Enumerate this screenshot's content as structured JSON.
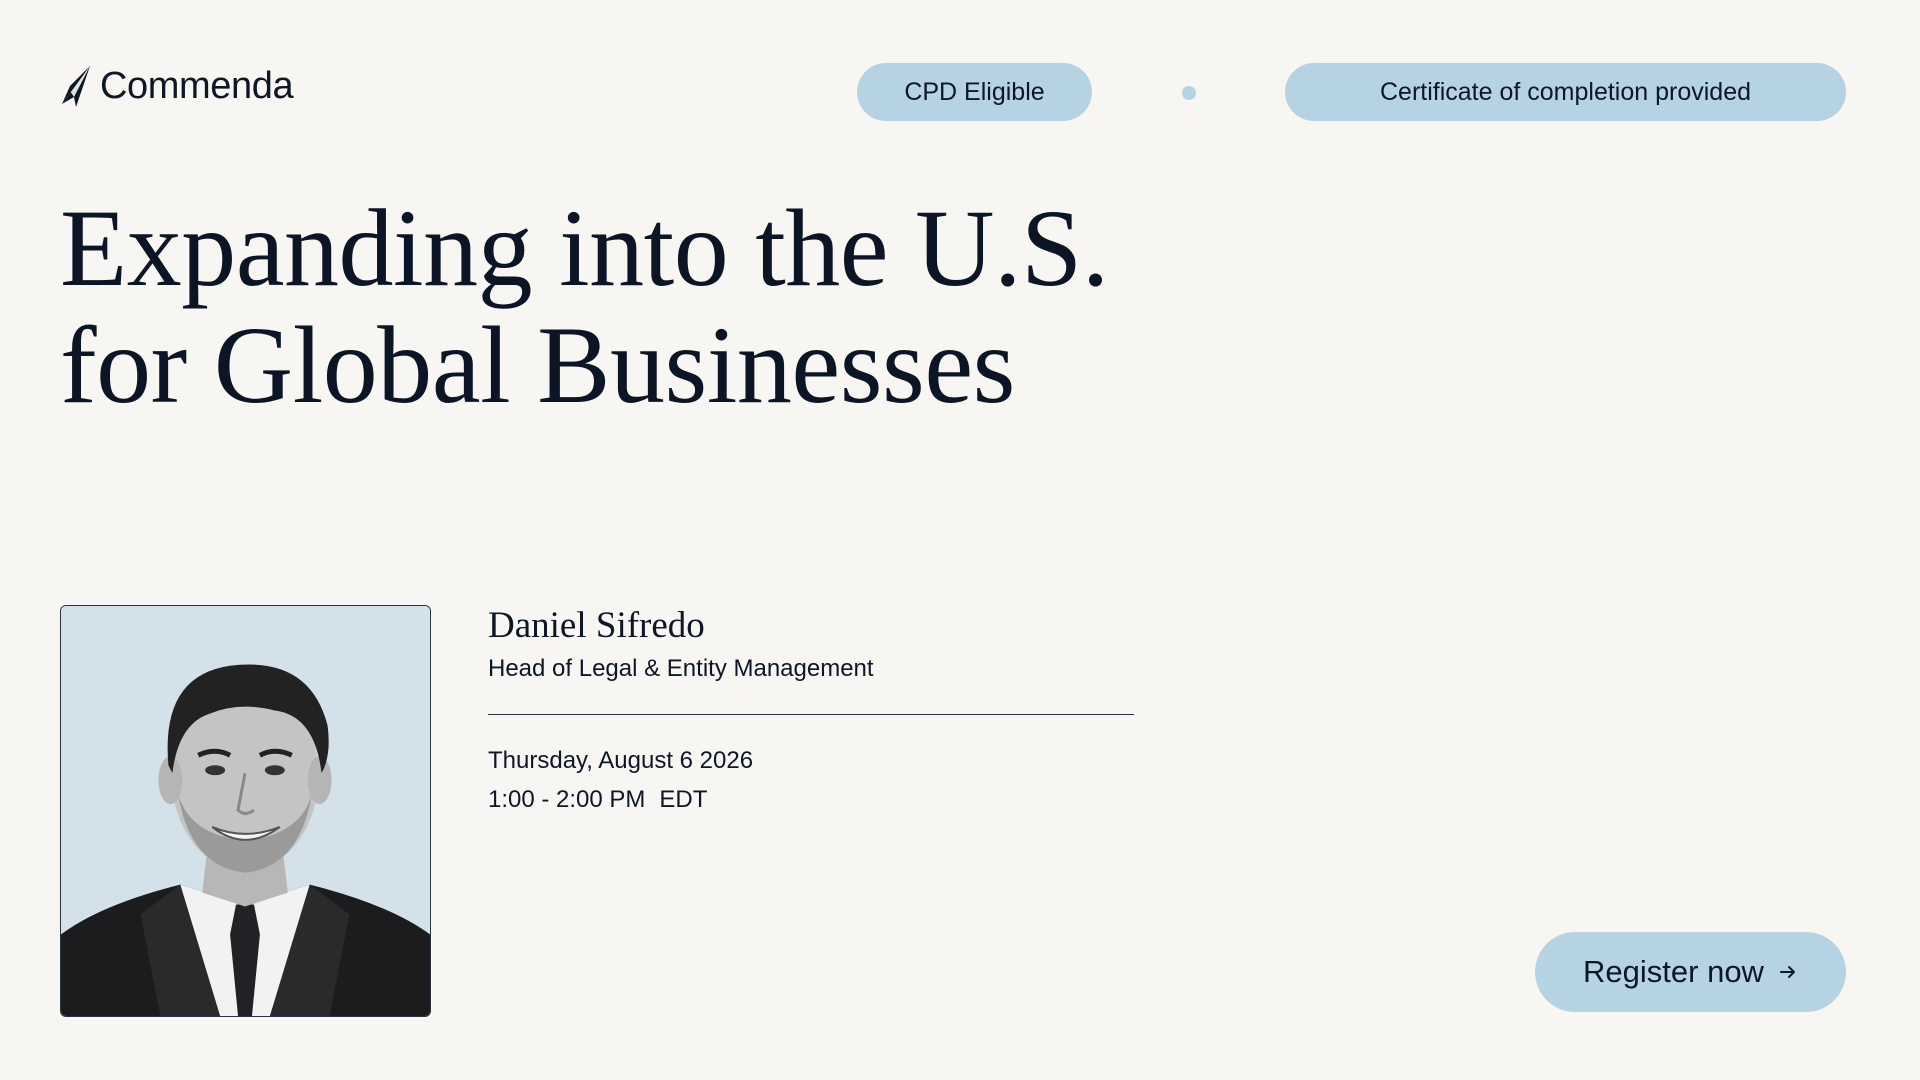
{
  "brand": {
    "name": "Commenda",
    "logo_icon": "paper-plane-icon"
  },
  "badges": {
    "cpd": "CPD Eligible",
    "certificate": "Certificate of completion provided"
  },
  "title": "Expanding into the U.S. for Global Businesses",
  "speaker": {
    "name": "Daniel Sifredo",
    "role": "Head of Legal & Entity Management"
  },
  "event": {
    "date": "Thursday, August 6 2026",
    "time": "1:00 - 2:00 PM",
    "timezone": "EDT"
  },
  "cta": {
    "label": "Register now",
    "icon": "arrow-right-icon"
  },
  "colors": {
    "background": "#f7f6f2",
    "accent": "#b5d3e3",
    "text": "#0e1726",
    "photo_background": "#d3e1ea"
  }
}
